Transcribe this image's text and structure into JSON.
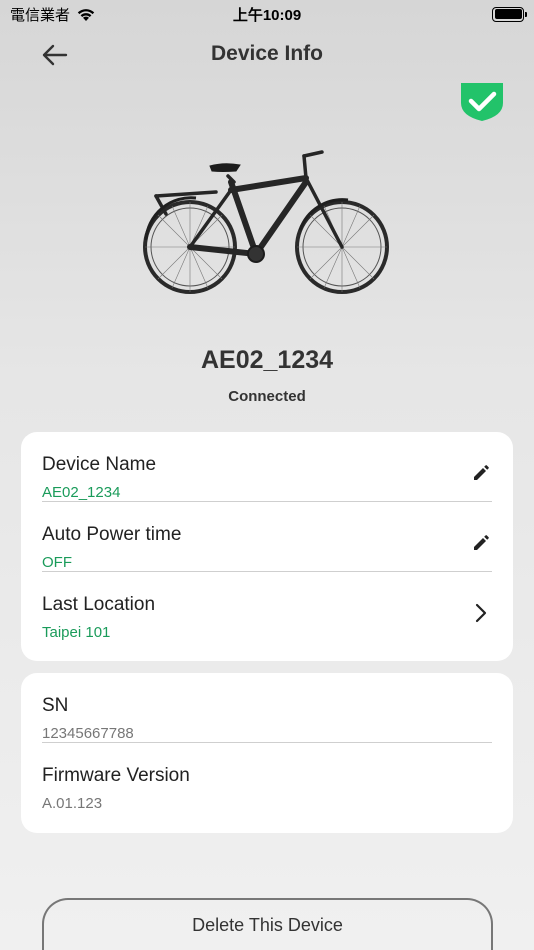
{
  "status_bar": {
    "carrier": "電信業者",
    "time": "上午10:09"
  },
  "header": {
    "title": "Device Info"
  },
  "device": {
    "name": "AE02_1234",
    "status": "Connected"
  },
  "settings_card": {
    "rows": [
      {
        "label": "Device Name",
        "value": "AE02_1234",
        "action": "pencil-icon"
      },
      {
        "label": "Auto Power time",
        "value": "OFF",
        "action": "pencil-icon"
      },
      {
        "label": "Last Location",
        "value": "Taipei 101",
        "action": "chevron-right-icon"
      }
    ]
  },
  "info_card": {
    "rows": [
      {
        "label": "SN",
        "value": "12345667788"
      },
      {
        "label": "Firmware Version",
        "value": "A.01.123"
      }
    ]
  },
  "actions": {
    "delete_label": "Delete This Device"
  },
  "colors": {
    "accent_green": "#1a9b5a",
    "badge_green": "#22c36a"
  }
}
